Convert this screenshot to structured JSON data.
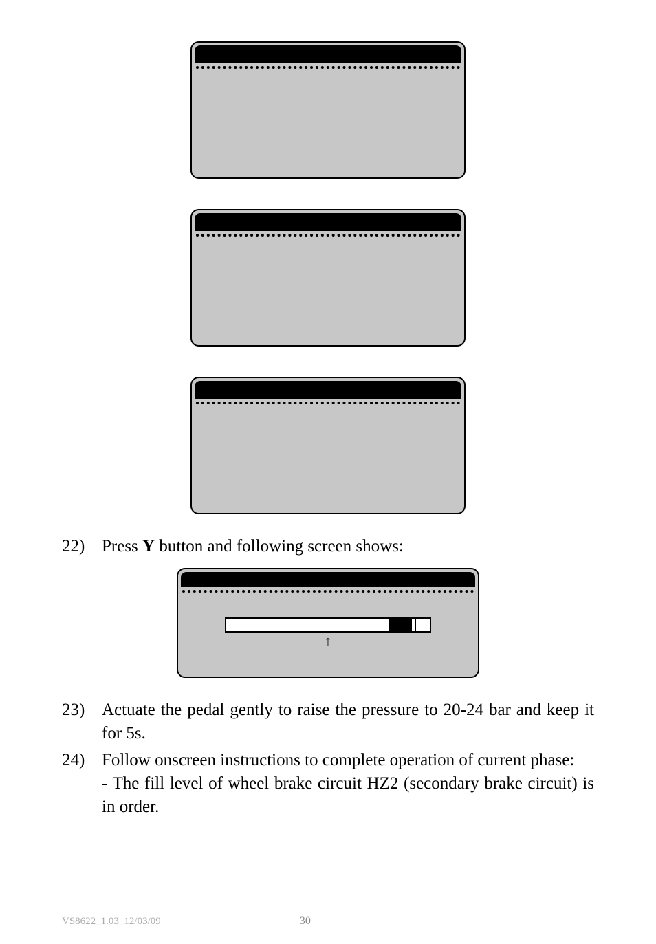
{
  "screens": {
    "s1": {
      "header": ""
    },
    "s2": {
      "header": ""
    },
    "s3": {
      "header": ""
    },
    "s4": {
      "header": "",
      "arrow": "↑"
    }
  },
  "steps": {
    "s22": {
      "num": "22)",
      "text_a": "Press ",
      "bold": "Y",
      "text_b": " button and following screen shows:"
    },
    "s23": {
      "num": "23)",
      "text": "Actuate the pedal gently to raise the pressure to 20-24 bar and keep it for 5s."
    },
    "s24": {
      "num": "24)",
      "text": "Follow onscreen instructions to complete operation of current phase:",
      "sub": "- The fill level of wheel brake circuit HZ2 (secondary brake circuit) is in order."
    }
  },
  "footer": {
    "left": "VS8622_1.03_12/03/09",
    "page": "30"
  }
}
